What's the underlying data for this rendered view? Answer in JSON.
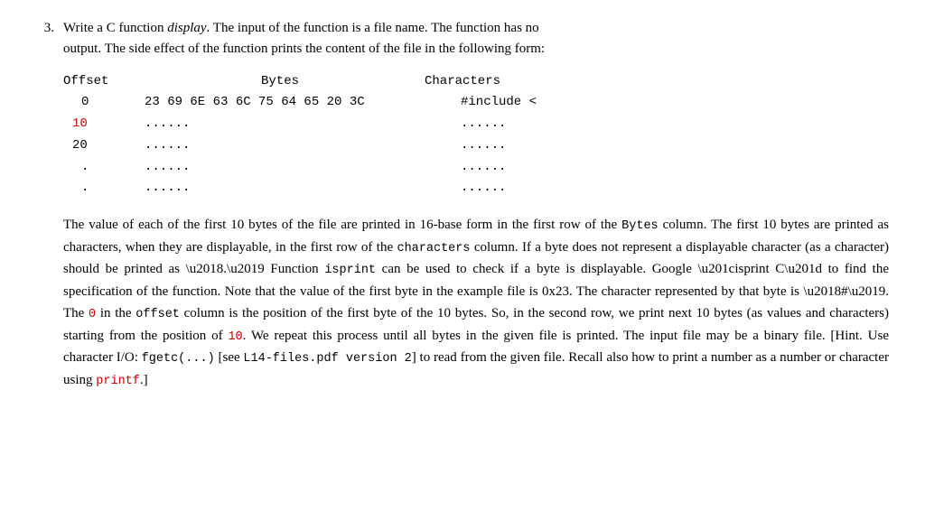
{
  "question": {
    "number": "3.",
    "intro_line1": "Write a C function ",
    "function_name": "display",
    "intro_line1_rest": ". The input of the function is a file name. The function has no",
    "intro_line2": "output. The side effect of the function prints the content of the file in the following form:",
    "table": {
      "headers": {
        "offset": "Offset",
        "bytes": "Bytes",
        "characters": "Characters"
      },
      "rows": [
        {
          "offset": "0",
          "bytes": "23 69 6E 63 6C 75 64 65 20 3C",
          "chars": "#include <"
        },
        {
          "offset": "10",
          "bytes": "......",
          "chars": "......"
        },
        {
          "offset": "20",
          "bytes": "......",
          "chars": "......"
        },
        {
          "offset": ".",
          "bytes": "......",
          "chars": "......"
        },
        {
          "offset": ".",
          "bytes": "......",
          "chars": "......"
        }
      ]
    },
    "description": [
      {
        "id": "para1",
        "parts": [
          {
            "type": "text",
            "content": "The value of each of the first 10 bytes of the file are printed in 16-base form in the first row of the "
          },
          {
            "type": "mono",
            "content": "Bytes"
          },
          {
            "type": "text",
            "content": " column. The first 10 bytes are printed as characters, when they are displayable, in the first row of the "
          },
          {
            "type": "mono",
            "content": "characters"
          },
          {
            "type": "text",
            "content": " column. If a byte does not represent a displayable character (as a character) should be printed as ‘.’ Function "
          },
          {
            "type": "mono",
            "content": "isprint"
          },
          {
            "type": "text",
            "content": " can be used to check if a byte is displayable. Google “isprint C” to find the specification of the function. Note that the value of the first byte in the example file is 0x23. The character represented by that byte is ‘#’. The "
          },
          {
            "type": "red_mono",
            "content": "0"
          },
          {
            "type": "text",
            "content": " in the "
          },
          {
            "type": "mono",
            "content": "offset"
          },
          {
            "type": "text",
            "content": " column is the position of the first byte of the 10 bytes. So, in the second row, we print next 10 bytes (as values and characters) starting from the position of "
          },
          {
            "type": "red_mono",
            "content": "10"
          },
          {
            "type": "text",
            "content": ". We repeat this process until all bytes in the given file is printed. The input file may be a binary file. [Hint. Use character I/O: "
          },
          {
            "type": "mono",
            "content": "fgetc(...)"
          },
          {
            "type": "text",
            "content": " [see "
          },
          {
            "type": "mono",
            "content": "L14-files.pdf version 2"
          },
          {
            "type": "text",
            "content": "] to read from the given file. Recall also how to print a number as a number or character using "
          },
          {
            "type": "red_mono",
            "content": "printf"
          },
          {
            "type": "text",
            "content": ".]"
          }
        ]
      }
    ]
  }
}
